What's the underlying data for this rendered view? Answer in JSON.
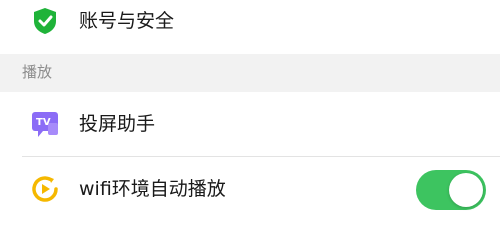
{
  "account_security": {
    "label": "账号与安全",
    "icon": "shield-check-icon",
    "icon_color": "#1fb339"
  },
  "playback_section": {
    "title": "播放"
  },
  "screen_cast": {
    "label": "投屏助手",
    "icon": "tv-cast-icon",
    "icon_color": "#8b6cf6",
    "icon_text": "TV"
  },
  "wifi_autoplay": {
    "label": "wifi环境自动播放",
    "icon": "play-circle-icon",
    "icon_color": "#f5b800",
    "toggle_on": true,
    "toggle_color": "#3dc460"
  },
  "colors": {
    "section_bg": "#f2f2f2",
    "divider": "#e3e3e3",
    "text": "#1a1a1a",
    "section_text": "#8c8c8c"
  }
}
